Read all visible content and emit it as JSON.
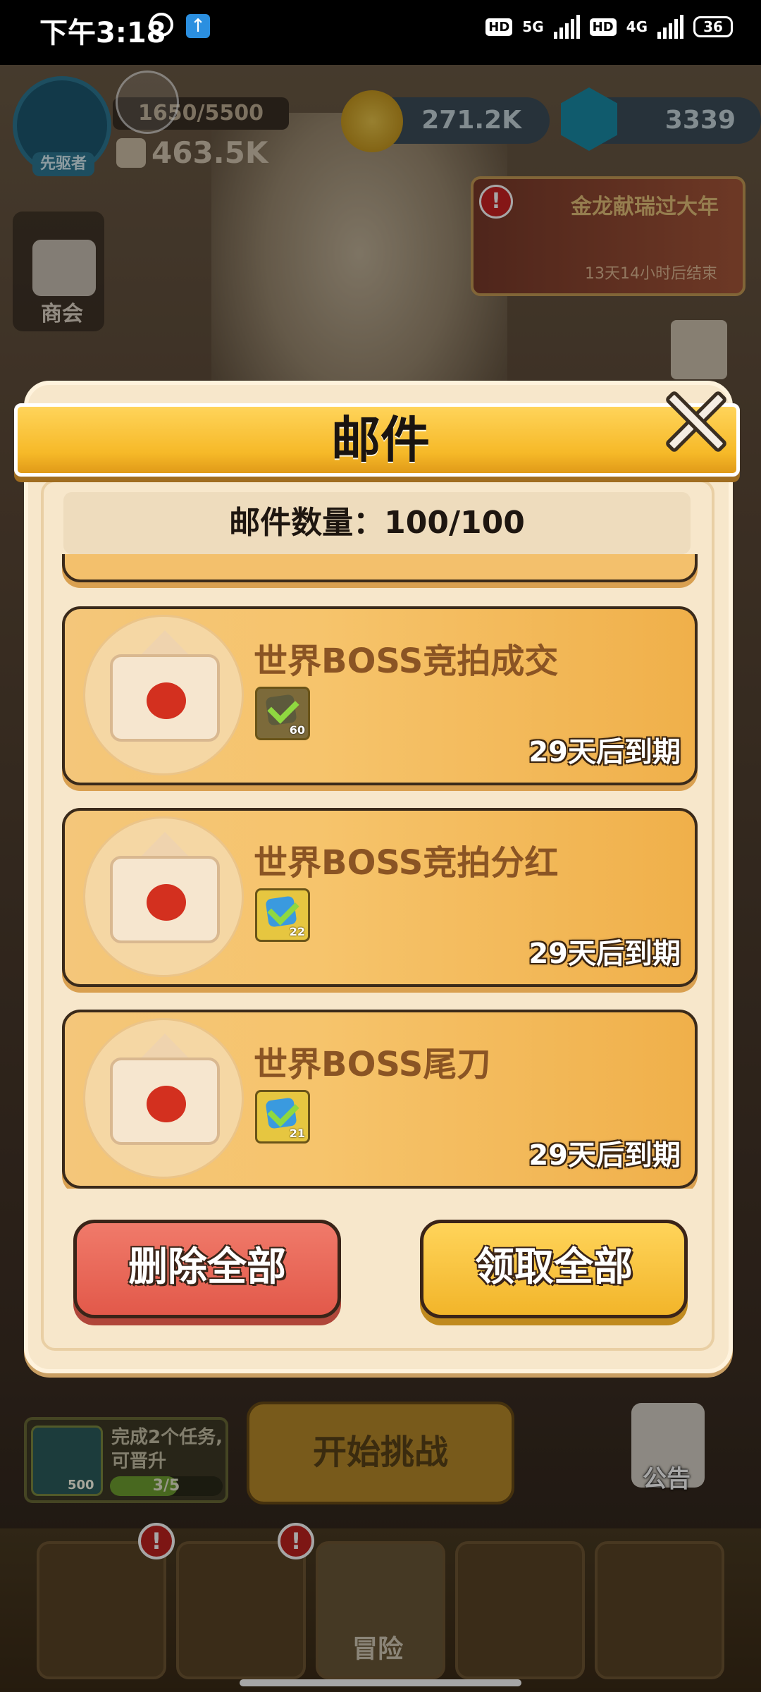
{
  "status_bar": {
    "time": "下午3:18",
    "hd1": "HD",
    "net1": "5G",
    "hd2": "HD",
    "net2": "4G",
    "battery": "36"
  },
  "hud": {
    "rank_label": "先驱者",
    "xp": "1650/5500",
    "power": "463.5K",
    "gold": "271.2K",
    "gems": "3339",
    "event_title": "金龙献瑞过大年",
    "event_time": "13天14小时后结束",
    "shop_label": "商会"
  },
  "modal": {
    "title": "邮件",
    "count_text": "邮件数量：100/100",
    "mails": [
      {
        "title": "世界BOSS竞拍成交",
        "item_count": "60",
        "expire": "29天后到期",
        "icon": "gear-item-icon"
      },
      {
        "title": "世界BOSS竞拍分红",
        "item_count": "22",
        "expire": "29天后到期",
        "icon": "blue-check-item-icon"
      },
      {
        "title": "世界BOSS尾刀",
        "item_count": "21",
        "expire": "29天后到期",
        "icon": "blue-check-item-icon"
      }
    ],
    "delete_all": "删除全部",
    "claim_all": "领取全部"
  },
  "bottom": {
    "task_text": "完成2个任务,可晋升",
    "task_gem_count": "500",
    "task_progress": "3/5",
    "task_progress_fraction": 0.6,
    "start_button": "开始挑战",
    "notice_label": "公告",
    "nav": [
      {
        "name": "banner",
        "label": "",
        "alert": true
      },
      {
        "name": "helmet",
        "label": "",
        "alert": true
      },
      {
        "name": "adventure",
        "label": "冒险",
        "alert": false
      },
      {
        "name": "target",
        "label": "",
        "alert": false
      },
      {
        "name": "trophy",
        "label": "",
        "alert": false
      }
    ]
  }
}
